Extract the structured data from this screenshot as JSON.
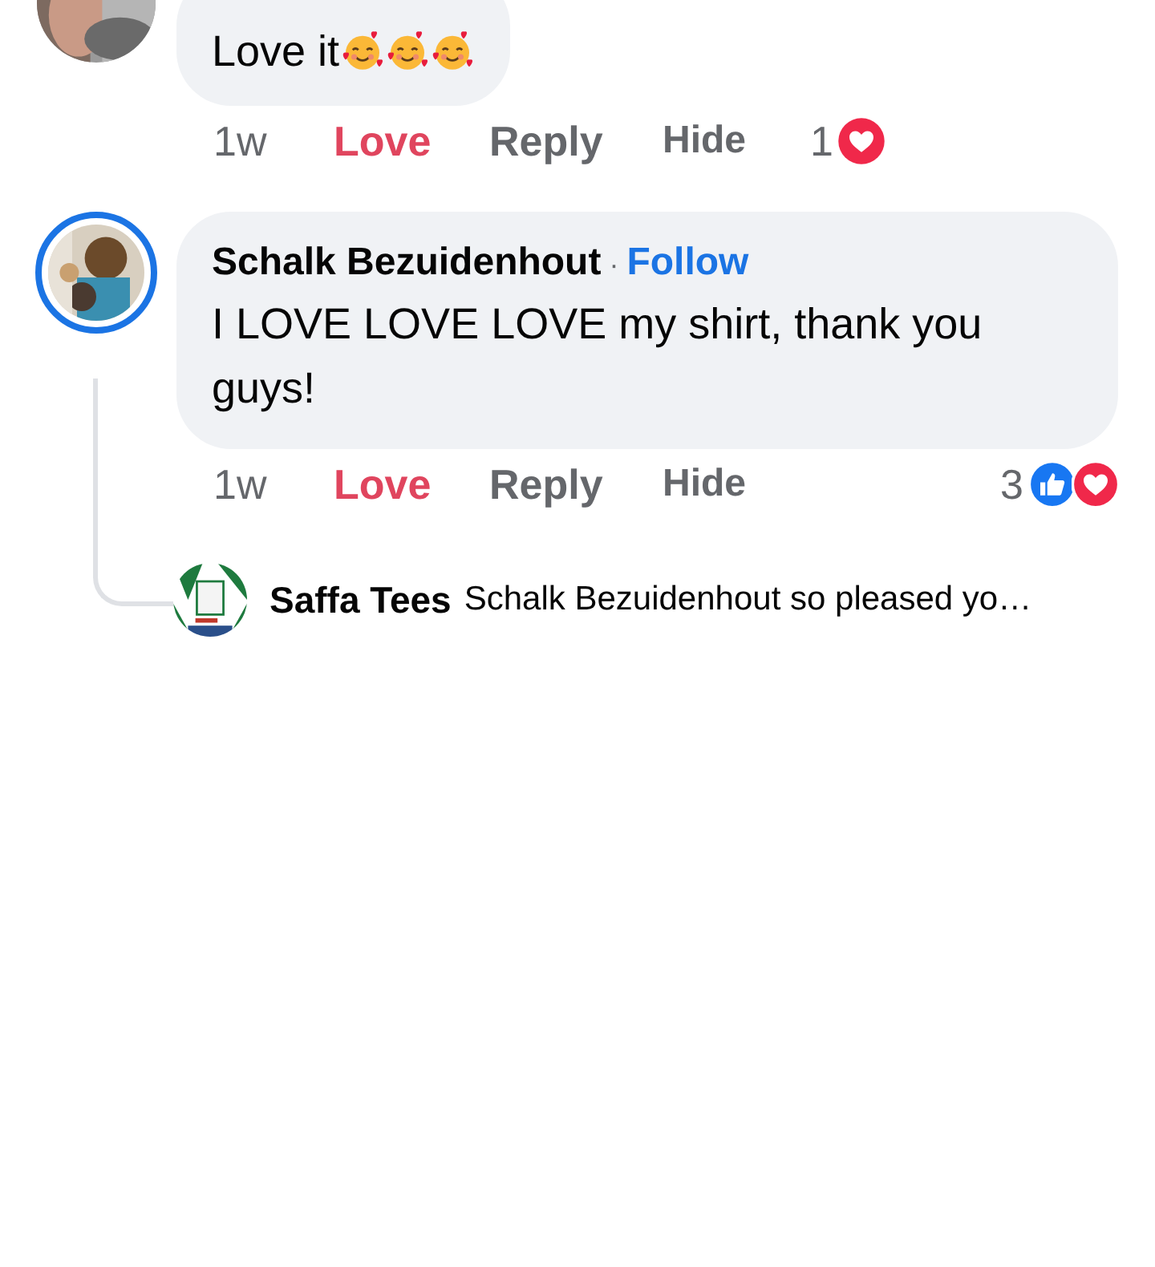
{
  "comments": [
    {
      "avatar": {
        "story_ring": false
      },
      "text": "Love it",
      "emojis": [
        {
          "kind": "smiling-hearts"
        },
        {
          "kind": "smiling-hearts"
        },
        {
          "kind": "smiling-hearts"
        }
      ],
      "time": "1w",
      "reaction": {
        "label": "Love",
        "active": true
      },
      "reply_label": "Reply",
      "hide_label": "Hide",
      "summary": {
        "kind": "inline",
        "count": "1",
        "reactions": [
          {
            "kind": "love"
          }
        ]
      }
    },
    {
      "avatar": {
        "story_ring": true
      },
      "author": "Schalk Bezuidenhout",
      "separator": "·",
      "follow": "Follow",
      "text": "I LOVE LOVE LOVE my shirt, thank you guys!",
      "time": "1w",
      "reaction": {
        "label": "Love",
        "active": true
      },
      "reply_label": "Reply",
      "hide_label": "Hide",
      "summary": {
        "kind": "right",
        "count": "3",
        "reactions": [
          {
            "kind": "like"
          },
          {
            "kind": "love"
          }
        ]
      },
      "replies": [
        {
          "author": "Saffa Tees",
          "text": "Schalk Bezuidenhout so pleased yo…"
        }
      ]
    }
  ]
}
